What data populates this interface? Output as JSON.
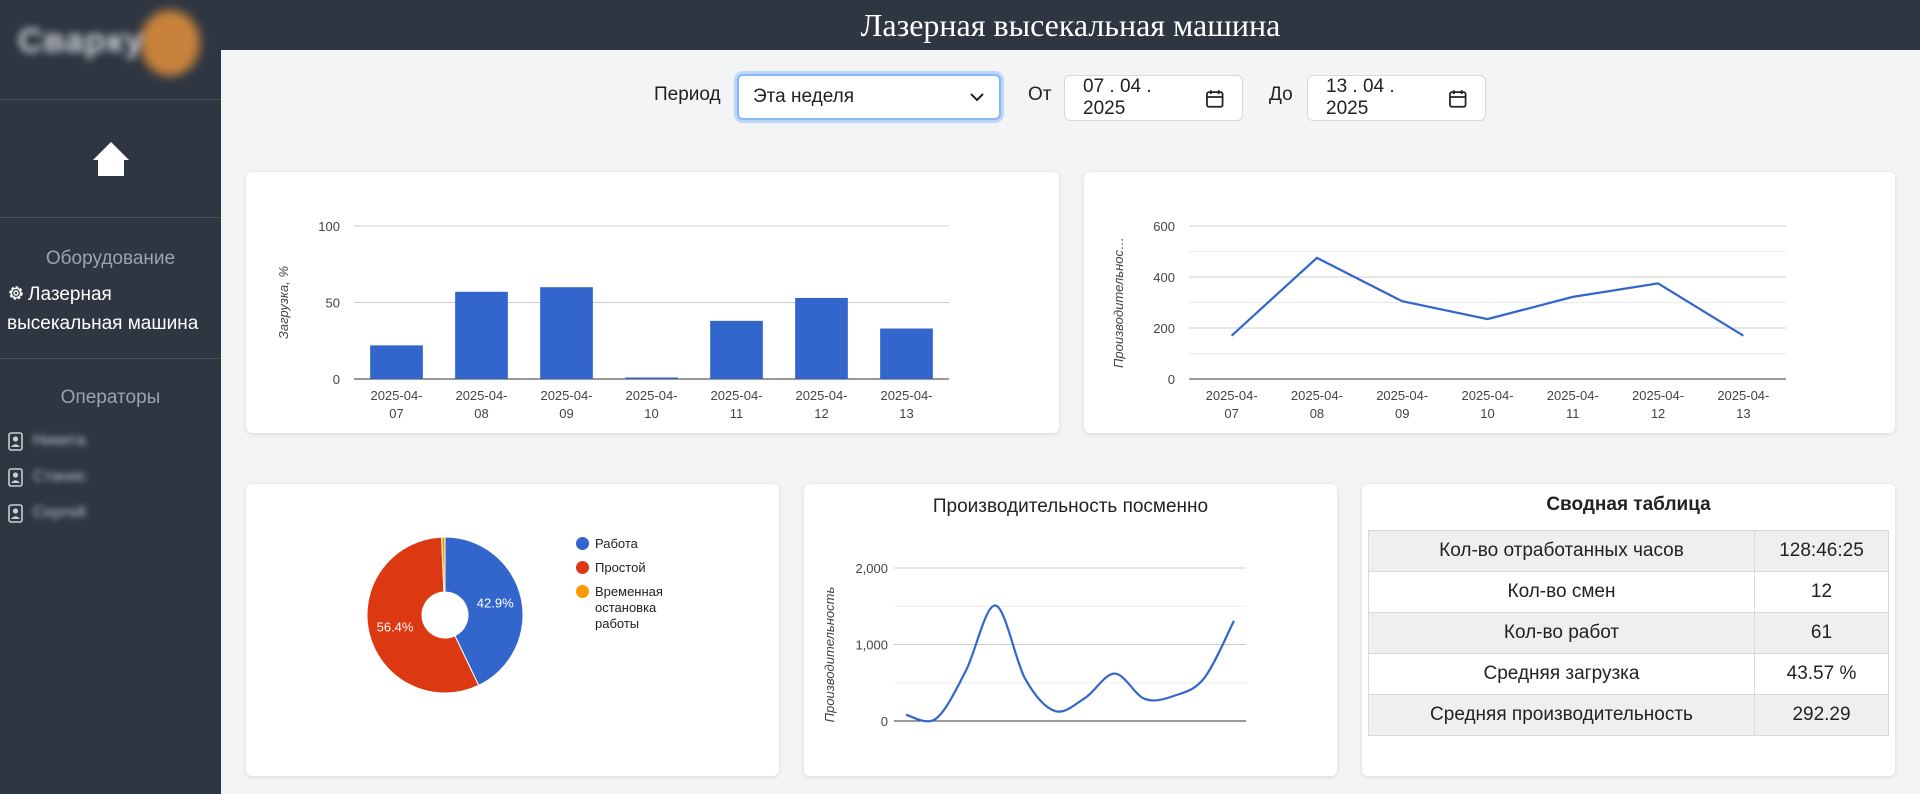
{
  "header": {
    "title": "Лазерная высекальная машина"
  },
  "sidebar": {
    "logo_text": "Сварку",
    "equipment_title": "Оборудование",
    "equipment_item": "Лазерная высекальная машина",
    "operators_title": "Операторы",
    "operators": [
      "Никита",
      "Станис",
      "Сергей"
    ]
  },
  "filters": {
    "period_label": "Период",
    "period_value": "Эта неделя",
    "from_label": "От",
    "from_value": "07 . 04 . 2025",
    "to_label": "До",
    "to_value": "13 . 04 . 2025"
  },
  "colors": {
    "blue": "#3366cc",
    "red": "#dc3912",
    "orange": "#ff9900",
    "sidebar": "#2e3642"
  },
  "chart_data": [
    {
      "type": "bar",
      "categories": [
        "2025-04-07",
        "2025-04-08",
        "2025-04-09",
        "2025-04-10",
        "2025-04-11",
        "2025-04-12",
        "2025-04-13"
      ],
      "values": [
        22,
        57,
        60,
        1,
        38,
        53,
        33
      ],
      "ylabel": "Загрузка, %",
      "ylim": [
        0,
        100
      ],
      "yticks": [
        "0",
        "50",
        "100"
      ]
    },
    {
      "type": "line",
      "categories": [
        "2025-04-07",
        "2025-04-08",
        "2025-04-09",
        "2025-04-10",
        "2025-04-11",
        "2025-04-12",
        "2025-04-13"
      ],
      "values": [
        170,
        475,
        305,
        235,
        322,
        375,
        170
      ],
      "ylabel": "Производительнос…",
      "ylim": [
        0,
        600
      ],
      "yticks": [
        "0",
        "200",
        "400",
        "600"
      ]
    },
    {
      "type": "pie",
      "labels": [
        "Работа",
        "Простой",
        "Временная остановка работы"
      ],
      "values": [
        42.9,
        56.4,
        0.7
      ],
      "slice_labels": [
        "42.9%",
        "56.4%"
      ]
    },
    {
      "type": "line",
      "title": "Производительность посменно",
      "ylabel": "Производительность",
      "ylim": [
        0,
        2000
      ],
      "yticks": [
        "0",
        "1,000",
        "2,000"
      ],
      "x": [
        1,
        2,
        3,
        4,
        5,
        6,
        7,
        8,
        9,
        10,
        11,
        12
      ],
      "values": [
        80,
        30,
        650,
        1510,
        550,
        130,
        300,
        620,
        290,
        330,
        560,
        1310
      ]
    }
  ],
  "summary": {
    "title": "Сводная таблица",
    "rows": [
      {
        "label": "Кол-во отработанных часов",
        "value": "128:46:25"
      },
      {
        "label": "Кол-во смен",
        "value": "12"
      },
      {
        "label": "Кол-во работ",
        "value": "61"
      },
      {
        "label": "Средняя загрузка",
        "value": "43.57 %"
      },
      {
        "label": "Средняя производительность",
        "value": "292.29"
      }
    ]
  }
}
